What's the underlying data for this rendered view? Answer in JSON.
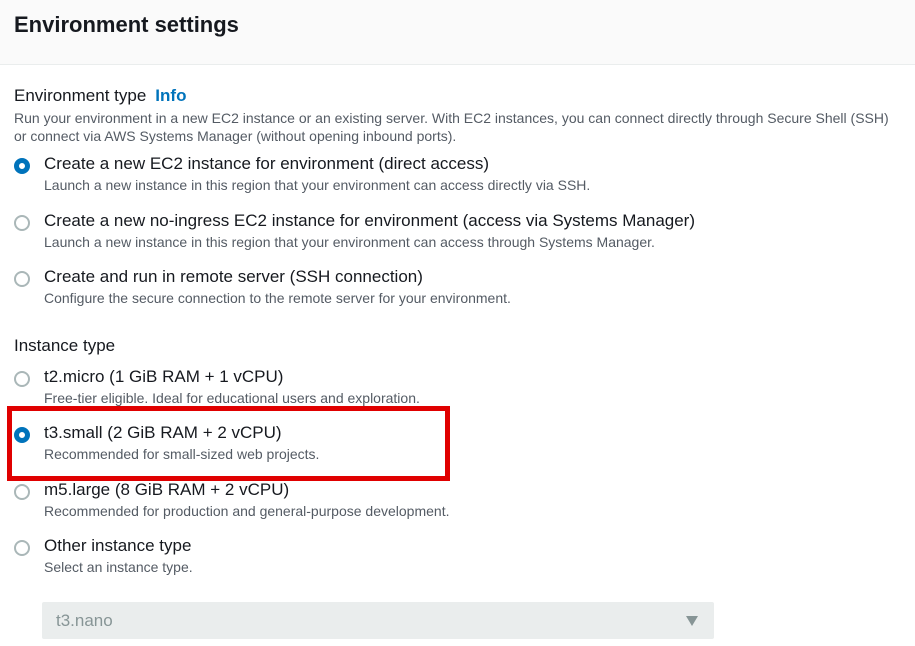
{
  "header": {
    "title": "Environment settings"
  },
  "environment_type": {
    "label": "Environment type",
    "info": "Info",
    "description": "Run your environment in a new EC2 instance or an existing server. With EC2 instances, you can connect directly through Secure Shell (SSH) or connect via AWS Systems Manager (without opening inbound ports).",
    "options": [
      {
        "label": "Create a new EC2 instance for environment (direct access)",
        "description": "Launch a new instance in this region that your environment can access directly via SSH.",
        "selected": true
      },
      {
        "label": "Create a new no-ingress EC2 instance for environment (access via Systems Manager)",
        "description": "Launch a new instance in this region that your environment can access through Systems Manager.",
        "selected": false
      },
      {
        "label": "Create and run in remote server (SSH connection)",
        "description": "Configure the secure connection to the remote server for your environment.",
        "selected": false
      }
    ]
  },
  "instance_type": {
    "label": "Instance type",
    "options": [
      {
        "label": "t2.micro (1 GiB RAM + 1 vCPU)",
        "description": "Free-tier eligible. Ideal for educational users and exploration.",
        "selected": false
      },
      {
        "label": "t3.small (2 GiB RAM + 2 vCPU)",
        "description": "Recommended for small-sized web projects.",
        "selected": true
      },
      {
        "label": "m5.large (8 GiB RAM + 2 vCPU)",
        "description": "Recommended for production and general-purpose development.",
        "selected": false
      },
      {
        "label": "Other instance type",
        "description": "Select an instance type.",
        "selected": false
      }
    ],
    "other_select": {
      "value": "t3.nano",
      "disabled": true
    }
  },
  "colors": {
    "accent": "#0073bb",
    "highlight": "#e00000",
    "text": "#16191f",
    "muted": "#545b64"
  },
  "icons": {
    "select_caret": "caret-down-icon"
  }
}
